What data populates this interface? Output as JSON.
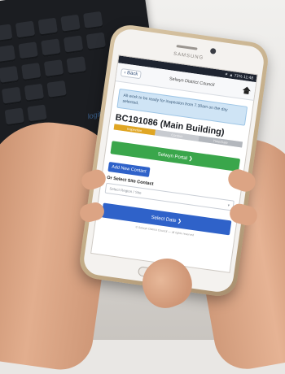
{
  "keyboard": {
    "brand_text": "logitech"
  },
  "phone": {
    "brand": "SAMSUNG",
    "status_time": "11:48",
    "status_icons": "✶ ▲ 71%",
    "app": {
      "back_label": "‹ Back",
      "title": "Selwyn District Council",
      "notice": "All work to be ready for inspection from 7.30am on the day selected.",
      "building": "BC191086 (Main Building)",
      "progress_steps": [
        "Inspection",
        "Contact",
        "Time/Date"
      ],
      "progress_fraction": 0.33,
      "primary_button": "Selwyn Portal ❯",
      "add_contact_button": "Add New Contact",
      "or_label": "Or Select Site Contact",
      "select_placeholder": "Select Region / Site",
      "select_date_button": "Select Date ❯",
      "footer": "© Selwyn District Council — all rights reserved"
    }
  },
  "colors": {
    "green": "#3aa64b",
    "blue": "#2f62c9",
    "amber": "#e0a623",
    "notice_bg": "#cfe4f5"
  }
}
